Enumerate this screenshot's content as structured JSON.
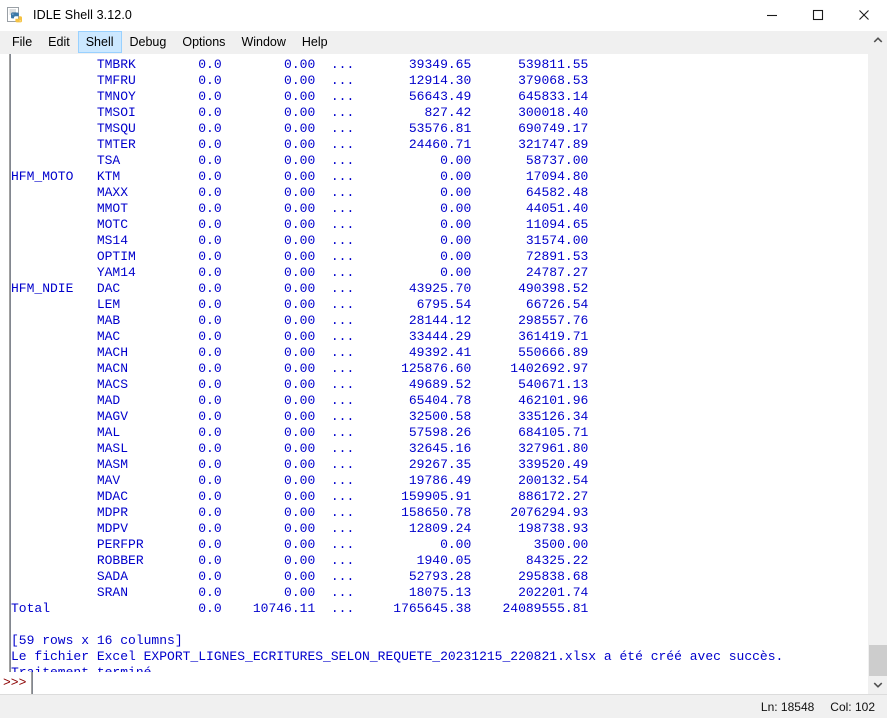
{
  "window": {
    "title": "IDLE Shell 3.12.0",
    "icon": "python-idle-icon",
    "controls": {
      "minimize": "minimize-icon",
      "maximize": "maximize-icon",
      "close": "close-icon"
    }
  },
  "menubar": {
    "items": [
      {
        "label": "File",
        "accel": "F",
        "active": false
      },
      {
        "label": "Edit",
        "accel": "E",
        "active": false
      },
      {
        "label": "Shell",
        "accel": "l",
        "active": true
      },
      {
        "label": "Debug",
        "accel": "D",
        "active": false
      },
      {
        "label": "Options",
        "accel": "O",
        "active": false
      },
      {
        "label": "Window",
        "accel": "W",
        "active": false
      },
      {
        "label": "Help",
        "accel": "H",
        "active": false
      }
    ]
  },
  "shell": {
    "prompt": ">>>",
    "lines": [
      "           TMBRK        0.0        0.00  ...       39349.65      539811.55",
      "           TMFRU        0.0        0.00  ...       12914.30      379068.53",
      "           TMNOY        0.0        0.00  ...       56643.49      645833.14",
      "           TMSOI        0.0        0.00  ...         827.42      300018.40",
      "           TMSQU        0.0        0.00  ...       53576.81      690749.17",
      "           TMTER        0.0        0.00  ...       24460.71      321747.89",
      "           TSA          0.0        0.00  ...           0.00       58737.00",
      "HFM_MOTO   KTM          0.0        0.00  ...           0.00       17094.80",
      "           MAXX         0.0        0.00  ...           0.00       64582.48",
      "           MMOT         0.0        0.00  ...           0.00       44051.40",
      "           MOTC         0.0        0.00  ...           0.00       11094.65",
      "           MS14         0.0        0.00  ...           0.00       31574.00",
      "           OPTIM        0.0        0.00  ...           0.00       72891.53",
      "           YAM14        0.0        0.00  ...           0.00       24787.27",
      "HFM_NDIE   DAC          0.0        0.00  ...       43925.70      490398.52",
      "           LEM          0.0        0.00  ...        6795.54       66726.54",
      "           MAB          0.0        0.00  ...       28144.12      298557.76",
      "           MAC          0.0        0.00  ...       33444.29      361419.71",
      "           MACH         0.0        0.00  ...       49392.41      550666.89",
      "           MACN         0.0        0.00  ...      125876.60     1402692.97",
      "           MACS         0.0        0.00  ...       49689.52      540671.13",
      "           MAD          0.0        0.00  ...       65404.78      462101.96",
      "           MAGV         0.0        0.00  ...       32500.58      335126.34",
      "           MAL          0.0        0.00  ...       57598.26      684105.71",
      "           MASL         0.0        0.00  ...       32645.16      327961.80",
      "           MASM         0.0        0.00  ...       29267.35      339520.49",
      "           MAV          0.0        0.00  ...       19786.49      200132.54",
      "           MDAC         0.0        0.00  ...      159905.91      886172.27",
      "           MDPR         0.0        0.00  ...      158650.78     2076294.93",
      "           MDPV         0.0        0.00  ...       12809.24      198738.93",
      "           PERFPR       0.0        0.00  ...           0.00        3500.00",
      "           ROBBER       0.0        0.00  ...        1940.05       84325.22",
      "           SADA         0.0        0.00  ...       52793.28      295838.68",
      "           SRAN         0.0        0.00  ...       18075.13      202201.74",
      "Total                   0.0    10746.11  ...     1765645.38    24089555.81",
      "",
      "[59 rows x 16 columns]",
      "Le fichier Excel EXPORT_LIGNES_ECRITURES_SELON_REQUETE_20231215_220821.xlsx a été créé avec succès.",
      "Traitement terminé."
    ]
  },
  "scrollbar": {
    "up_arrow": "chevron-up-icon",
    "down_arrow": "chevron-down-icon",
    "thumb_top_pct": 95.0,
    "thumb_height_pct": 5.0
  },
  "statusbar": {
    "line_label": "Ln: 18548",
    "col_label": "Col: 102"
  },
  "colors": {
    "code_text": "#0000cc",
    "prompt": "#8b0000",
    "menu_active_bg": "#cce8ff",
    "chrome_bg": "#f0f0f0",
    "editor_bg": "#ffffff"
  }
}
